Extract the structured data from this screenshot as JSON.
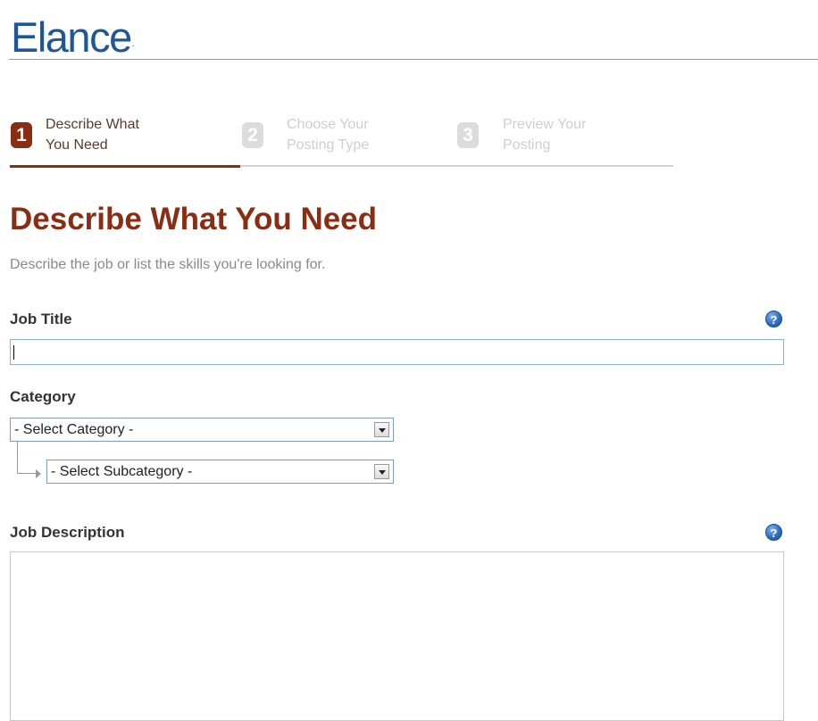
{
  "logo": {
    "text": "Elance",
    "mark": "."
  },
  "steps": [
    {
      "number": "1",
      "line1": "Describe What",
      "line2": "You Need",
      "active": true
    },
    {
      "number": "2",
      "line1": "Choose Your",
      "line2": "Posting Type",
      "active": false
    },
    {
      "number": "3",
      "line1": "Preview Your",
      "line2": "Posting",
      "active": false
    }
  ],
  "heading": {
    "title": "Describe What You Need",
    "subtitle": "Describe the job or list the skills you're looking for."
  },
  "form": {
    "job_title": {
      "label": "Job Title",
      "value": "",
      "help": "?"
    },
    "category": {
      "label": "Category",
      "selected": "- Select Category -",
      "subcategory_selected": "- Select Subcategory -"
    },
    "job_description": {
      "label": "Job Description",
      "value": "",
      "help": "?"
    }
  },
  "colors": {
    "brand_blue": "#1d5799",
    "accent_rust": "#8a2d12",
    "inactive_gray": "#dcdcdc"
  }
}
